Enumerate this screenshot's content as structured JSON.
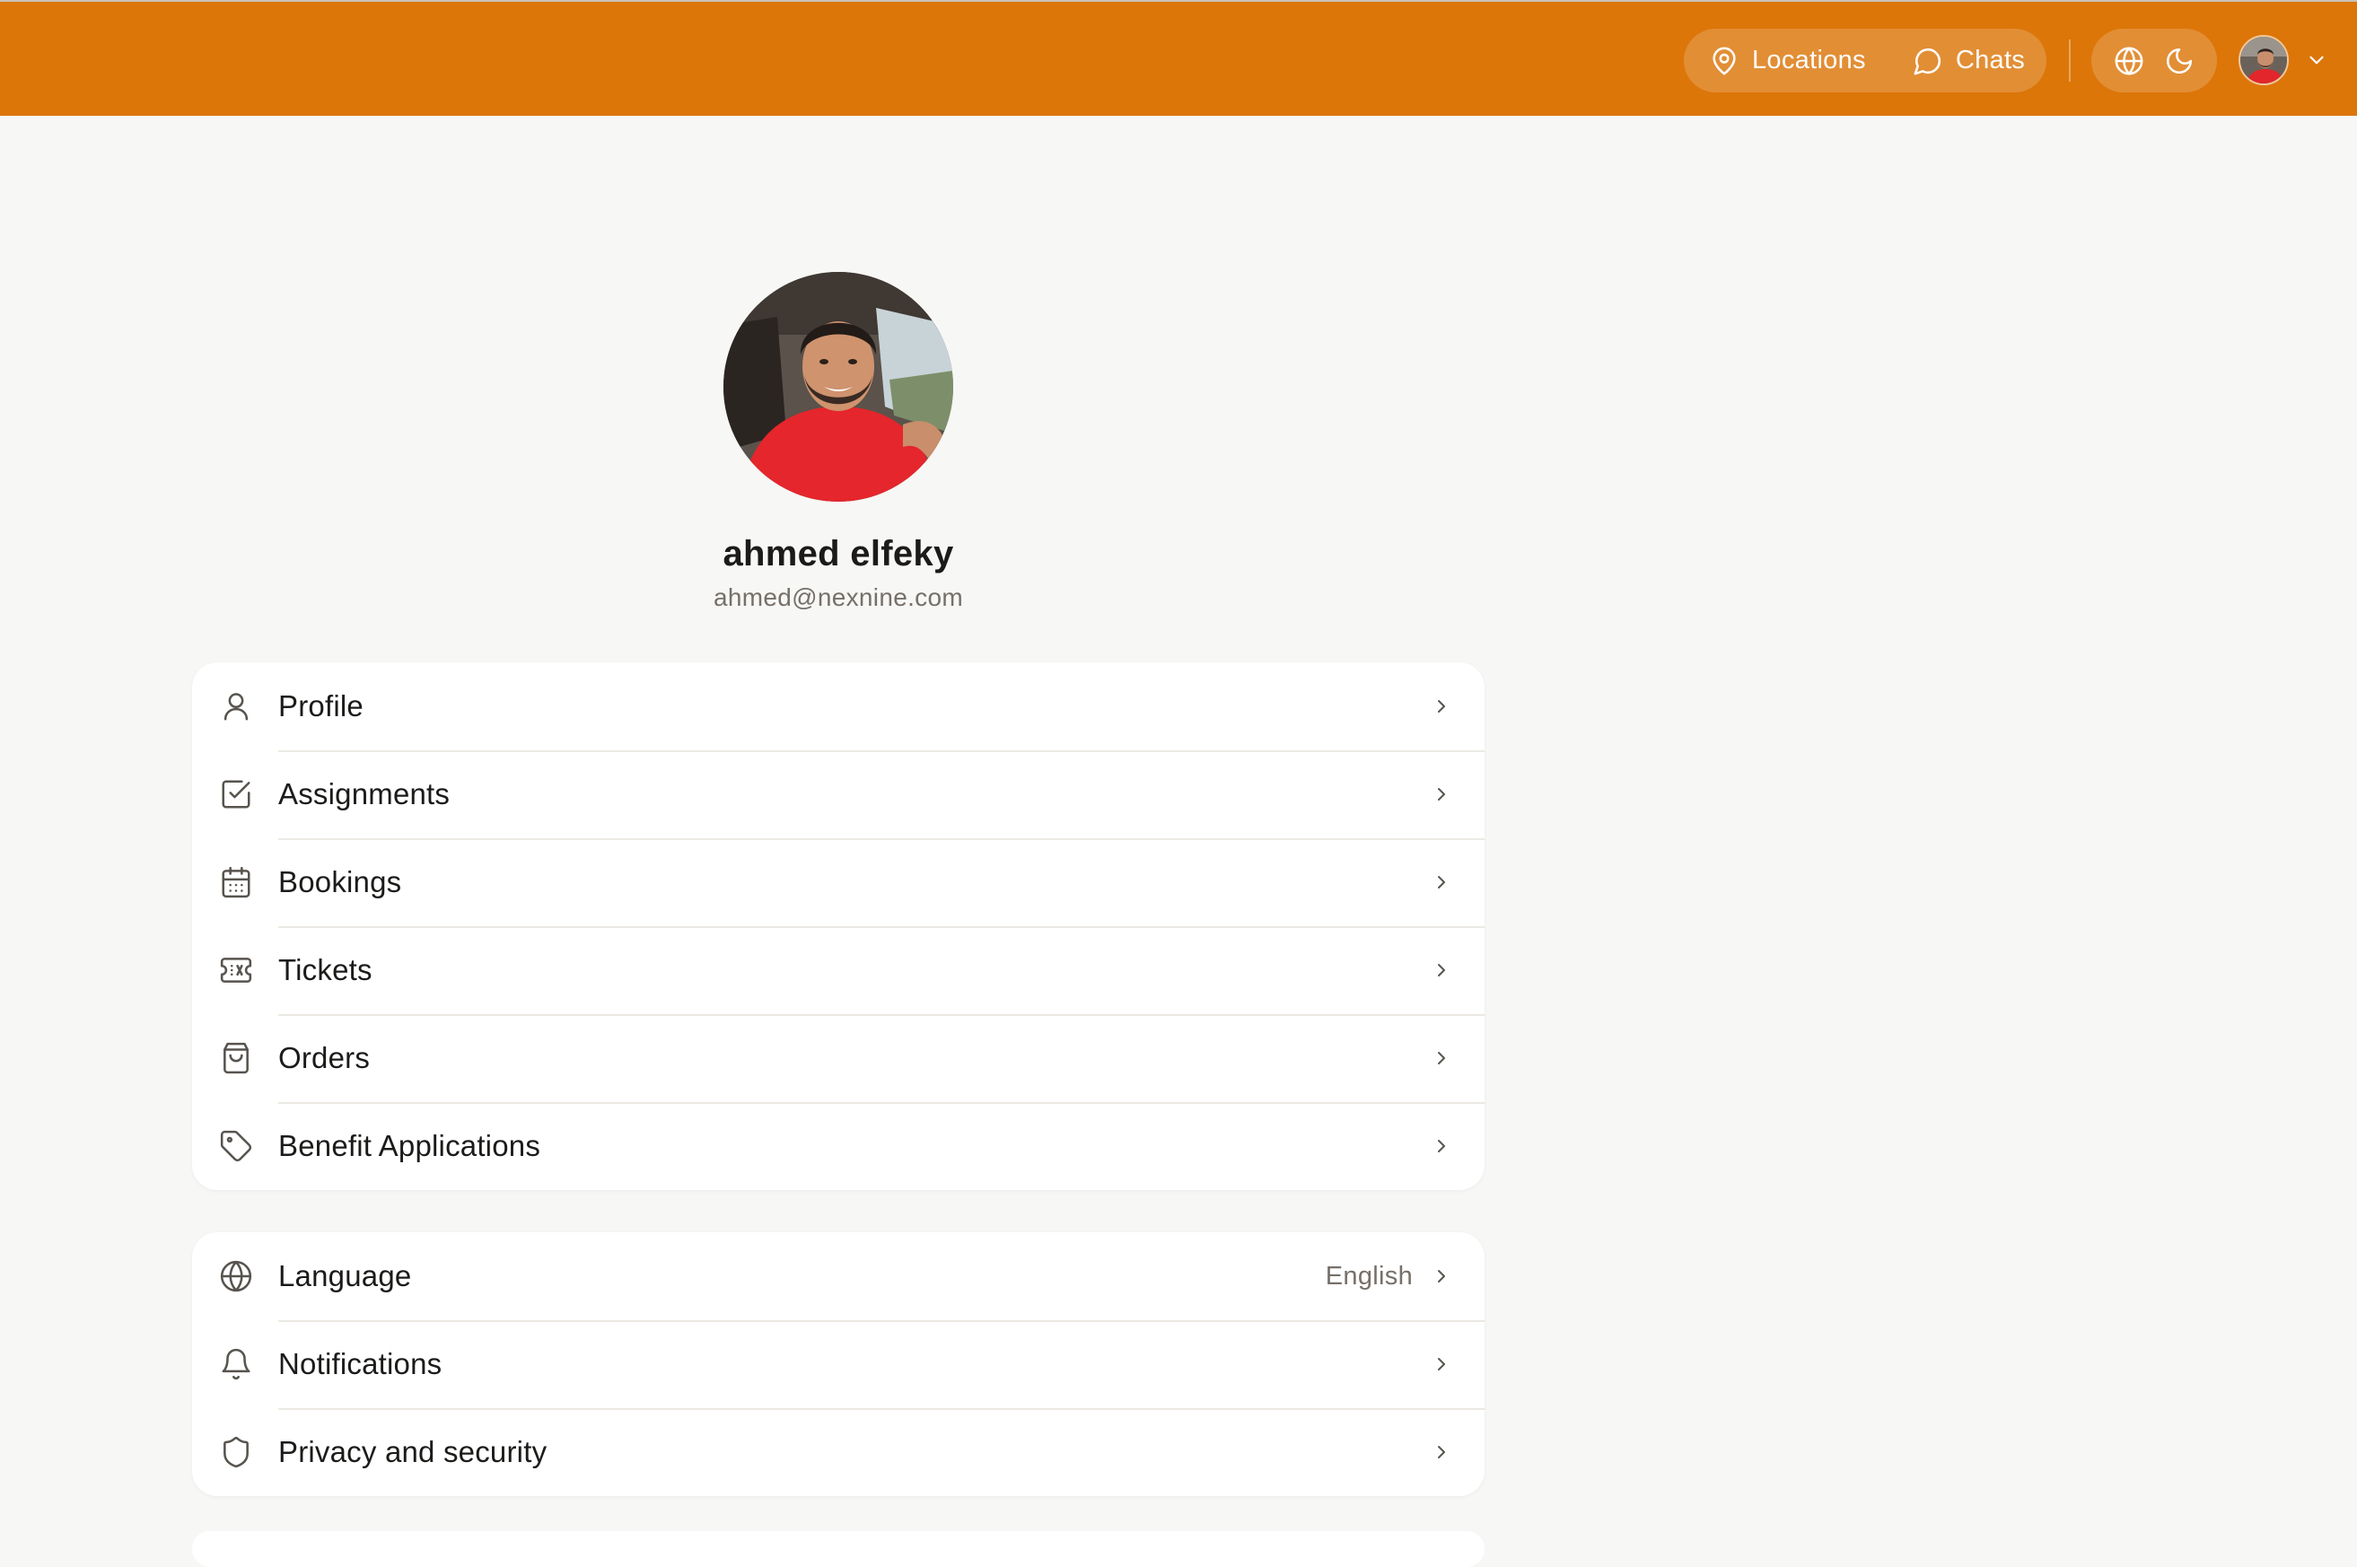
{
  "colors": {
    "header": "#dc7609",
    "page_background": "#f7f7f5",
    "card_background": "#ffffff",
    "text": "#1c1b19",
    "muted_text": "#76706a"
  },
  "header": {
    "nav": [
      {
        "label": "Locations",
        "icon": "map-pin-icon"
      },
      {
        "label": "Chats",
        "icon": "message-circle-icon"
      }
    ],
    "tools": [
      {
        "icon": "globe-icon"
      },
      {
        "icon": "moon-icon"
      }
    ],
    "account_menu_icon": "chevron-down-icon"
  },
  "user": {
    "name": "ahmed elfeky",
    "email": "ahmed@nexnine.com"
  },
  "account_menu": [
    {
      "label": "Profile",
      "icon": "user-icon"
    },
    {
      "label": "Assignments",
      "icon": "square-check-icon"
    },
    {
      "label": "Bookings",
      "icon": "calendar-icon"
    },
    {
      "label": "Tickets",
      "icon": "ticket-icon"
    },
    {
      "label": "Orders",
      "icon": "shopping-bag-icon"
    },
    {
      "label": "Benefit Applications",
      "icon": "tag-icon"
    }
  ],
  "settings_menu": [
    {
      "label": "Language",
      "value": "English",
      "icon": "globe-icon"
    },
    {
      "label": "Notifications",
      "icon": "bell-icon"
    },
    {
      "label": "Privacy and security",
      "icon": "shield-icon"
    }
  ]
}
